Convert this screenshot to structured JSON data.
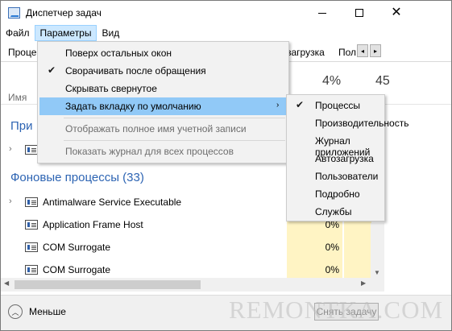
{
  "window": {
    "title": "Диспетчер задач",
    "close_glyph": "✕"
  },
  "menubar": [
    "Файл",
    "Параметры",
    "Вид"
  ],
  "tabs": {
    "left": "Проце",
    "autorun": "загрузка",
    "users": "Пол",
    "scroll_left": "◂",
    "scroll_right": "▸"
  },
  "columns": {
    "name": "Имя",
    "cpu_pct": "4%",
    "mem_pct": "45"
  },
  "sections": {
    "apps_partial": "При",
    "background": "Фоновые процессы (33)"
  },
  "processes": [
    {
      "name": "Antimalware Service Executable",
      "cpu": ""
    },
    {
      "name": "Application Frame Host",
      "cpu": "0%"
    },
    {
      "name": "COM Surrogate",
      "cpu": "0%"
    },
    {
      "name": "COM Surrogate",
      "cpu": "0%"
    }
  ],
  "options_menu": {
    "items": [
      {
        "label": "Поверх остальных окон",
        "checked": false,
        "enabled": true
      },
      {
        "label": "Сворачивать после обращения",
        "checked": true,
        "enabled": true
      },
      {
        "label": "Скрывать свернутое",
        "checked": false,
        "enabled": true
      },
      {
        "label": "Задать вкладку по умолчанию",
        "checked": false,
        "enabled": true,
        "submenu": true
      },
      {
        "label": "Отображать полное имя учетной записи",
        "checked": false,
        "enabled": false
      },
      {
        "label": "Показать журнал для всех процессов",
        "checked": false,
        "enabled": false
      }
    ],
    "check_glyph": "✔",
    "submenu_arrow": "›"
  },
  "default_tab_submenu": {
    "items": [
      {
        "label": "Процессы",
        "checked": true
      },
      {
        "label": "Производительность",
        "checked": false
      },
      {
        "label": "Журнал приложений",
        "checked": false
      },
      {
        "label": "Автозагрузка",
        "checked": false
      },
      {
        "label": "Пользователи",
        "checked": false
      },
      {
        "label": "Подробно",
        "checked": false
      },
      {
        "label": "Службы",
        "checked": false
      }
    ]
  },
  "footer": {
    "less_label": "Меньше",
    "end_task_label": "Снять задачу",
    "less_glyph": "︿"
  },
  "watermark": "REMONTKA.COM",
  "colors": {
    "accent": "#2d64b3",
    "highlight": "#91c9f7",
    "cpu_fill": "#fff4c4"
  }
}
